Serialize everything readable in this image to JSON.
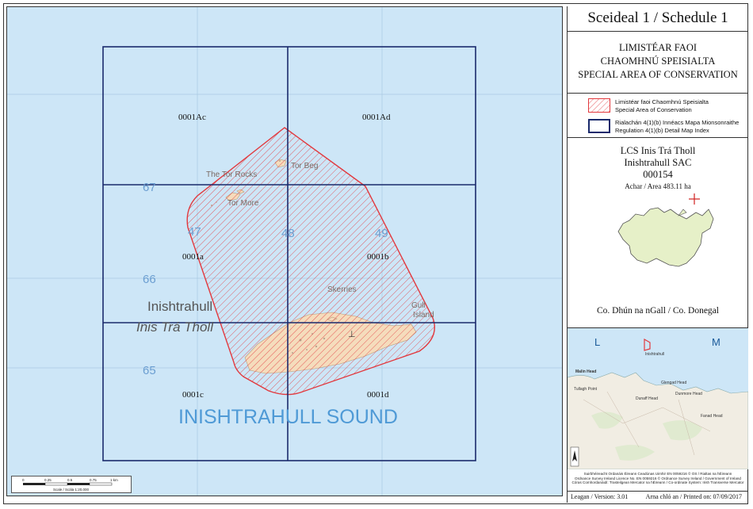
{
  "schedule_title": "Sceideal 1 / Schedule 1",
  "designation": {
    "line1": "LIMISTÉAR FAOI",
    "line2": "CHAOMHNÚ SPEISIALTA",
    "line3": "SPECIAL AREA OF CONSERVATION"
  },
  "legend": [
    {
      "line1": "Limistéar faoi Chaomhnú Speisialta",
      "line2": "Special Area of Conservation",
      "style": "hatch",
      "color": "#e2393e"
    },
    {
      "line1": "Rialachán 4(1)(b) Innéacs Mapa Mionsonraithe",
      "line2": "Regulation 4(1)(b) Detail Map Index",
      "style": "outline",
      "color": "#1a2a6c"
    }
  ],
  "site": {
    "name_irish": "LCS Inis Trá Tholl",
    "name_english": "Inishtrahull SAC",
    "code": "000154",
    "area": "Achar / Area 483.11 ha",
    "county": "Co. Dhún na nGall / Co. Donegal"
  },
  "inset": {
    "label_left": "L",
    "label_right": "M",
    "site_label": "Inishtrahull",
    "places": [
      "Malin Head",
      "Glengad Head",
      "Dunaff Head",
      "Dunmore Head",
      "Fanad Head",
      "Tullagh Point"
    ]
  },
  "map": {
    "tiles": [
      "0001Ac",
      "0001Ad",
      "0001a",
      "0001b",
      "0001c",
      "0001d"
    ],
    "grid_numbers": [
      "67",
      "66",
      "65",
      "47",
      "48",
      "49"
    ],
    "features": {
      "the_tor_rocks": "The Tor Rocks",
      "tor_beg": "Tor Beg",
      "tor_more": "Tor More",
      "skerries": "Skerries",
      "gull_island_1": "Gull",
      "gull_island_2": "Island",
      "inishtrahull": "Inishtrahull",
      "inis_tra_tholl": "Inis Trá Tholl",
      "sound": "INISHTRAHULL SOUND"
    },
    "colors": {
      "sea": "#cde6f7",
      "land": "#f5dcbc",
      "boundary": "#e2393e",
      "index": "#1a2a6c"
    }
  },
  "scale": {
    "ticks": [
      "0",
      "0.25",
      "0.5",
      "0.75",
      "1 km"
    ],
    "label": "Scale / Scála 1:20,000"
  },
  "credits": [
    "Suirbhéireacht Ordanáis Éireann Ceadúnas Uimhir EN 0059216 © OS / Rialtas na hÉireann",
    "Ordnance Survey Ireland Licence No. EN 0059216 © Ordnance Survey Ireland / Government of Ireland",
    "Córas Comhordanáidí: Trasteilgean Mercator na hÉireann / Co-ordinate System: Irish Transverse Mercator"
  ],
  "footer": {
    "version": "Leagan / Version: 3.01",
    "printed": "Arna chló an / Printed on: 07/09/2017"
  }
}
